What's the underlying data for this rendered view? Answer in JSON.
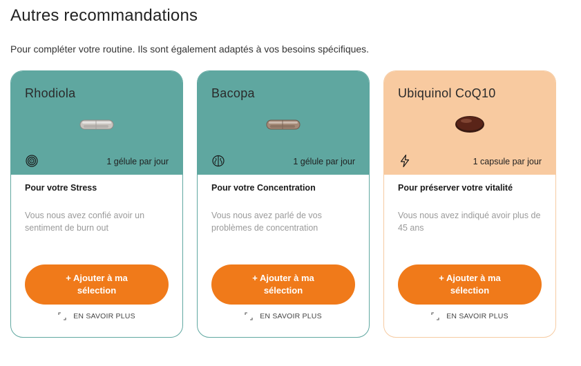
{
  "page": {
    "title": "Autres recommandations",
    "subtitle": "Pour compléter votre routine. Ils sont également adaptés à vos besoins spécifiques."
  },
  "colors": {
    "teal": "#5fa7a0",
    "peach": "#f8caa0",
    "orange_button": "#f07a1a"
  },
  "cards": [
    {
      "name": "Rhodiola",
      "top_color": "#5fa7a0",
      "pill": "clear-capsule",
      "dose_icon": "spiral-icon",
      "dose": "1 gélule par jour",
      "heading": "Pour votre Stress",
      "description": "Vous nous avez confié avoir un sentiment de burn out",
      "button": "+ Ajouter à ma sélection",
      "more": "EN SAVOIR PLUS"
    },
    {
      "name": "Bacopa",
      "top_color": "#5fa7a0",
      "pill": "brown-capsule",
      "dose_icon": "brain-icon",
      "dose": "1 gélule par jour",
      "heading": "Pour votre Concentration",
      "description": "Vous nous avez parlé de vos problèmes de concentration",
      "button": "+ Ajouter à ma sélection",
      "more": "EN SAVOIR PLUS"
    },
    {
      "name": "Ubiquinol CoQ10",
      "top_color": "#f8caa0",
      "pill": "softgel",
      "dose_icon": "lightning-icon",
      "dose": "1 capsule par jour",
      "heading": "Pour préserver votre vitalité",
      "description": "Vous nous avez indiqué avoir plus de 45 ans",
      "button": "+ Ajouter à ma sélection",
      "more": "EN SAVOIR PLUS"
    }
  ]
}
